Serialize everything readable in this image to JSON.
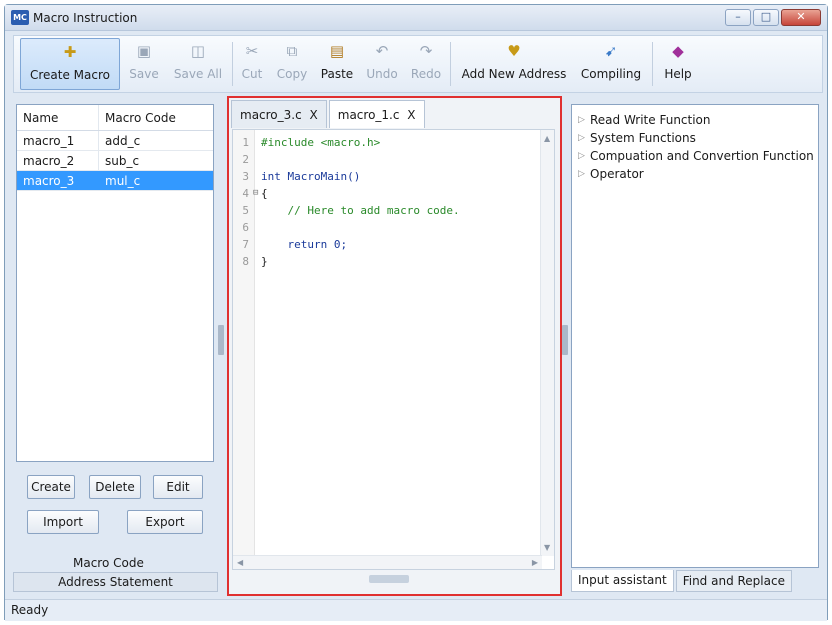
{
  "window": {
    "icon_text": "MC",
    "title": "Macro Instruction",
    "minimize": "–",
    "maximize": "□",
    "close": "✕"
  },
  "toolbar": {
    "create_macro": "Create Macro",
    "save": "Save",
    "save_all": "Save All",
    "cut": "Cut",
    "copy": "Copy",
    "paste": "Paste",
    "undo": "Undo",
    "redo": "Redo",
    "add_new_address": "Add New Address",
    "compiling": "Compiling",
    "help": "Help"
  },
  "macro_list": {
    "col_name": "Name",
    "col_code": "Macro Code",
    "rows": [
      {
        "name": "macro_1",
        "code": "add_c"
      },
      {
        "name": "macro_2",
        "code": "sub_c"
      },
      {
        "name": "macro_3",
        "code": "mul_c"
      }
    ],
    "selected_index": 2
  },
  "left_buttons": {
    "create": "Create",
    "delete": "Delete",
    "edit": "Edit",
    "import": "Import",
    "export": "Export"
  },
  "left_panel": {
    "macro_code_label": "Macro Code",
    "address_statement": "Address Statement"
  },
  "editor": {
    "tabs": [
      {
        "label": "macro_3.c",
        "close": "X"
      },
      {
        "label": "macro_1.c",
        "close": "X"
      }
    ],
    "lines": [
      {
        "n": "1",
        "fold": "",
        "text": "#include <macro.h>"
      },
      {
        "n": "2",
        "fold": "",
        "text": ""
      },
      {
        "n": "3",
        "fold": "",
        "text": "int MacroMain()"
      },
      {
        "n": "4",
        "fold": "⊟",
        "text": "{"
      },
      {
        "n": "5",
        "fold": "",
        "text": "    // Here to add macro code."
      },
      {
        "n": "6",
        "fold": "",
        "text": ""
      },
      {
        "n": "7",
        "fold": "",
        "text": "    return 0;"
      },
      {
        "n": "8",
        "fold": "",
        "text": "}"
      }
    ]
  },
  "assistant": {
    "tree": [
      "Read Write Function",
      "System Functions",
      "Compuation and Convertion Function",
      "Operator"
    ],
    "tabs": [
      "Input assistant",
      "Find and Replace"
    ]
  },
  "status": {
    "text": "Ready"
  },
  "colors": {
    "accent": "#3399ff",
    "highlight_frame": "#e03030",
    "directive": "#2a8a2a",
    "keyword": "#1a3a9a"
  }
}
